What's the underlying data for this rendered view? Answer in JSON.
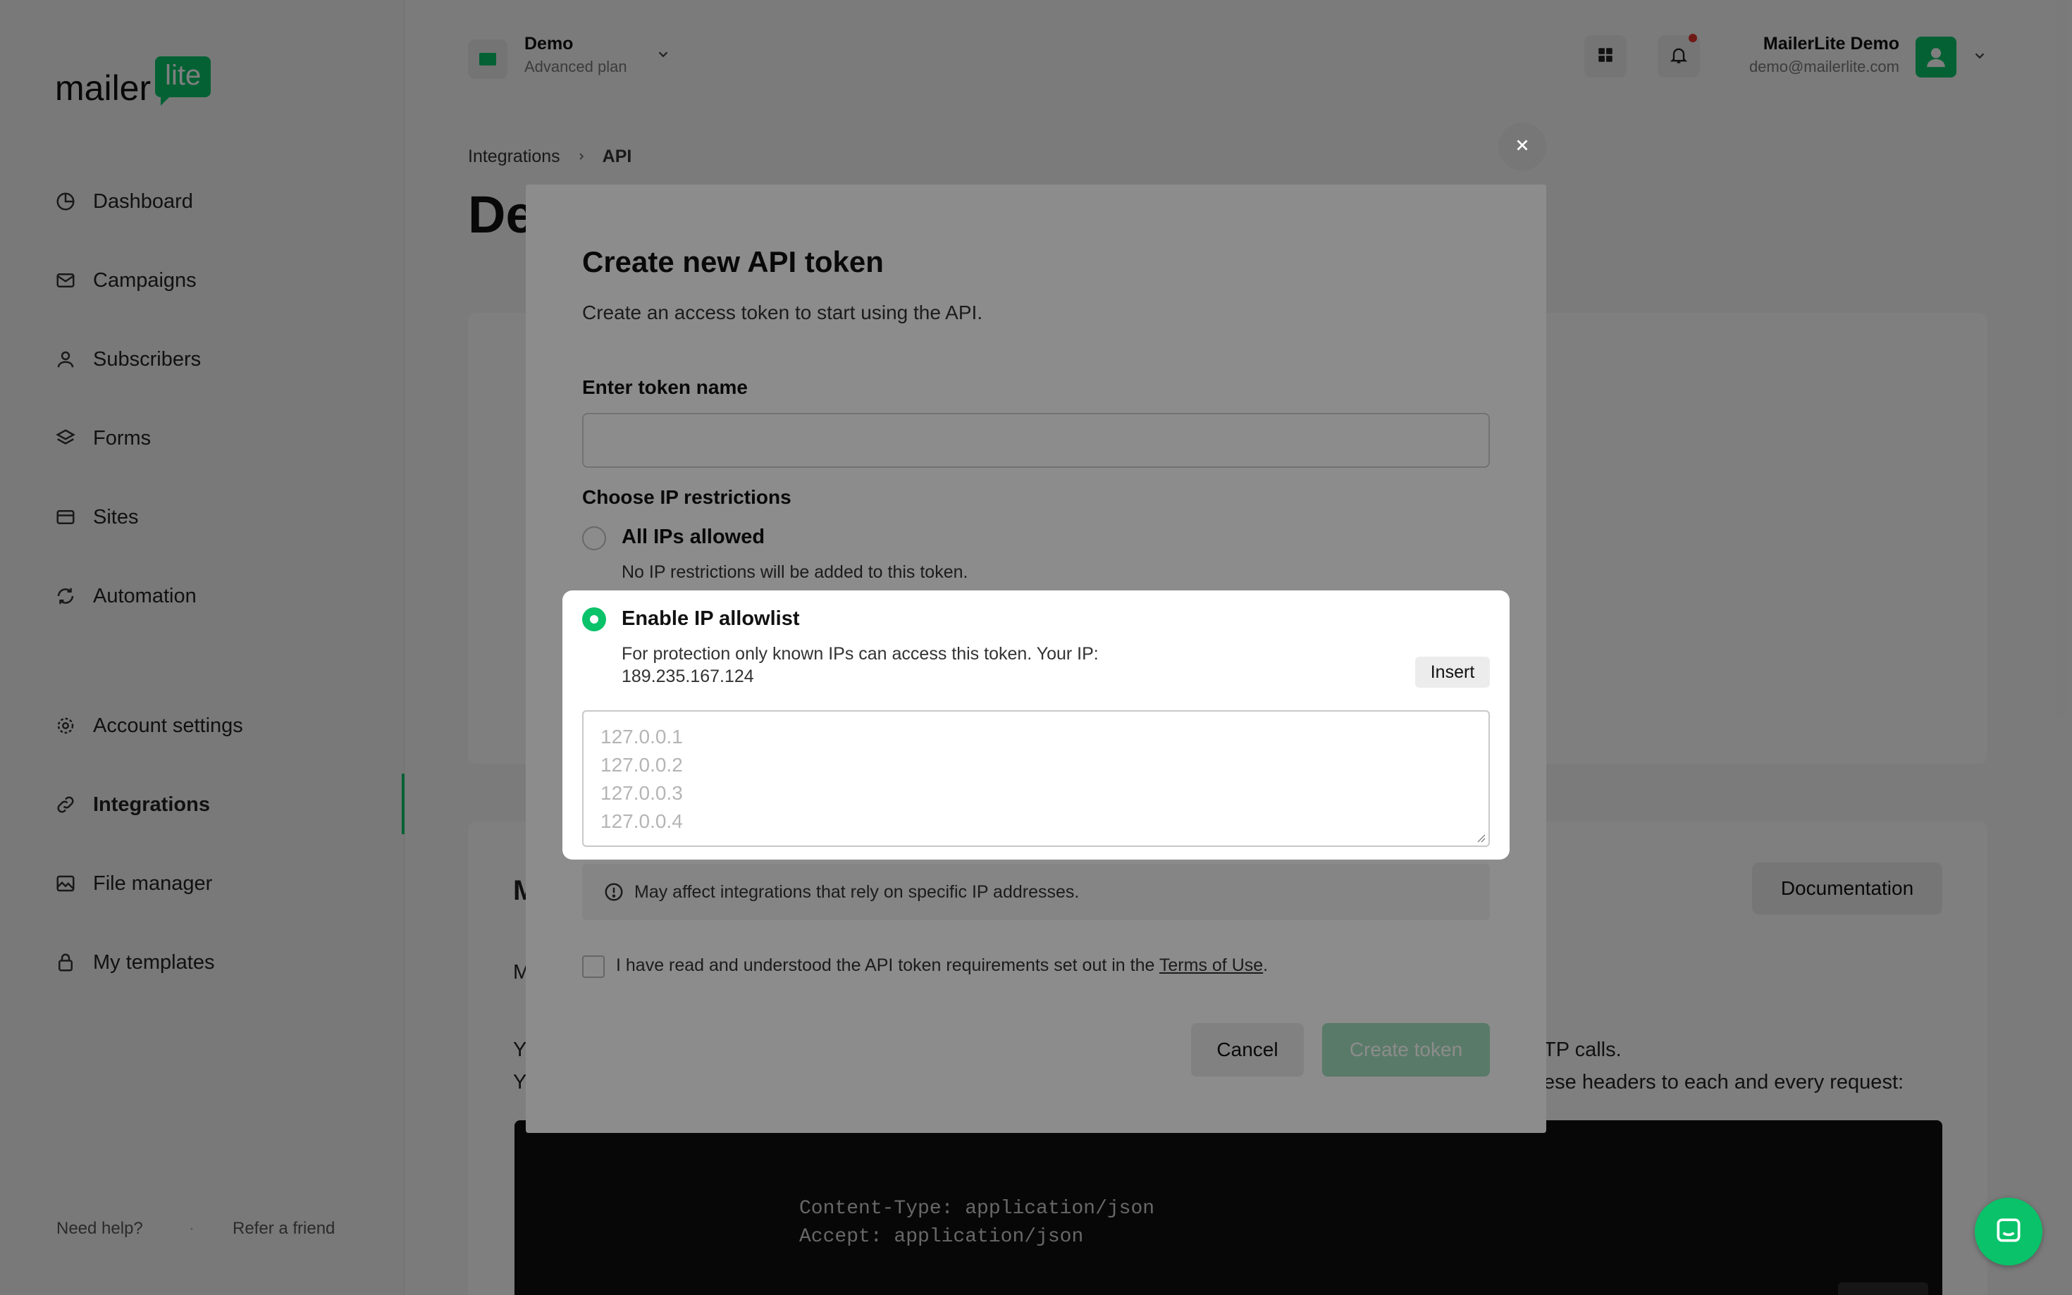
{
  "brand": {
    "logo_word": "mailer",
    "logo_badge": "lite",
    "accent": "#09c269"
  },
  "sidebar": {
    "items": [
      {
        "label": "Dashboard",
        "icon": "dashboard-icon"
      },
      {
        "label": "Campaigns",
        "icon": "mail-icon"
      },
      {
        "label": "Subscribers",
        "icon": "user-icon"
      },
      {
        "label": "Forms",
        "icon": "layers-icon"
      },
      {
        "label": "Sites",
        "icon": "browser-icon"
      },
      {
        "label": "Automation",
        "icon": "refresh-icon"
      },
      {
        "label": "Account settings",
        "icon": "gear-icon"
      },
      {
        "label": "Integrations",
        "icon": "link-icon",
        "active": true
      },
      {
        "label": "File manager",
        "icon": "image-icon"
      },
      {
        "label": "My templates",
        "icon": "lock-icon"
      }
    ],
    "footer": {
      "help": "Need help?",
      "refer": "Refer a friend"
    }
  },
  "topbar": {
    "account_name": "Demo",
    "account_plan": "Advanced plan",
    "user_name": "MailerLite Demo",
    "user_email": "demo@mailerlite.com"
  },
  "breadcrumb": {
    "parent": "Integrations",
    "current": "API"
  },
  "page": {
    "title_fragment": "De",
    "section_initial": "M",
    "section_line_initial": "M",
    "line1_initial": "Y",
    "line1_tail": "TP calls.",
    "line2_initial": "Y",
    "line2_tail": "ese headers to each and every request:",
    "documentation_button": "Documentation",
    "code_lines": [
      "Content-Type: application/json",
      "Accept: application/json"
    ]
  },
  "modal": {
    "title": "Create new API token",
    "subtitle": "Create an access token to start using the API.",
    "token_label": "Enter token name",
    "token_value": "",
    "ip_label": "Choose IP restrictions",
    "option_all": {
      "title": "All IPs allowed",
      "desc": "No IP restrictions will be added to this token.",
      "selected": false
    },
    "option_allowlist": {
      "title": "Enable IP allowlist",
      "desc_line1": "For protection only known IPs can access this token. Your IP:",
      "desc_line2": "189.235.167.124",
      "insert_label": "Insert",
      "selected": true,
      "placeholder_lines": [
        "127.0.0.1",
        "127.0.0.2",
        "127.0.0.3",
        "127.0.0.4"
      ]
    },
    "warning": "May affect integrations that rely on specific IP addresses.",
    "terms_text": "I have read and understood the API token requirements set out in the",
    "terms_link": "Terms of Use",
    "terms_end": ".",
    "cancel_label": "Cancel",
    "create_label": "Create token"
  }
}
